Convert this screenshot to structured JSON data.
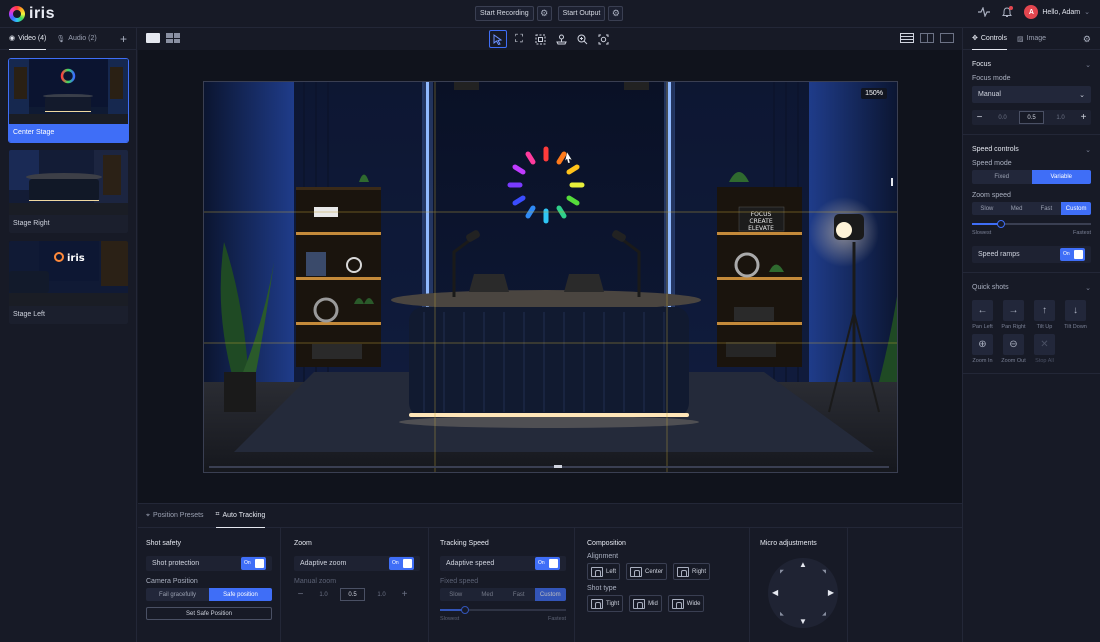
{
  "app": {
    "name": "iris"
  },
  "topbar": {
    "start_recording": "Start Recording",
    "start_output": "Start Output",
    "user_avatar_initial": "A",
    "greeting": "Hello, Adam"
  },
  "sources": {
    "video_tab": "Video (4)",
    "audio_tab": "Audio (2)",
    "items": [
      {
        "label": "Center Stage",
        "selected": true
      },
      {
        "label": "Stage Right",
        "selected": false
      },
      {
        "label": "Stage Left",
        "selected": false
      }
    ]
  },
  "preview": {
    "zoom": "150%",
    "sign_lines": [
      "FOCUS",
      "CREATE",
      "ELEVATE"
    ]
  },
  "bottom": {
    "tabs": [
      "Position Presets",
      "Auto Tracking"
    ],
    "active_tab": "Auto Tracking",
    "shot_safety": {
      "title": "Shot safety",
      "shot_protection": "Shot protection",
      "toggle_on": "On",
      "camera_position": "Camera Position",
      "options": [
        "Fail gracefully",
        "Safe position"
      ],
      "selected": "Safe position",
      "set_button": "Set Safe Position"
    },
    "zoom": {
      "title": "Zoom",
      "adaptive": "Adaptive zoom",
      "toggle_on": "On",
      "manual_label": "Manual zoom",
      "values": [
        "1.0",
        "0.5",
        "1.0"
      ]
    },
    "tracking_speed": {
      "title": "Tracking Speed",
      "adaptive": "Adaptive speed",
      "toggle_on": "On",
      "fixed_label": "Fixed speed",
      "options": [
        "Slow",
        "Med",
        "Fast",
        "Custom"
      ],
      "selected": "Custom",
      "slowest": "Slowest",
      "fastest": "Fastest",
      "level": 0.2
    },
    "composition": {
      "title": "Composition",
      "alignment_label": "Alignment",
      "alignment": [
        "Left",
        "Center",
        "Right"
      ],
      "shot_type_label": "Shot type",
      "shot_types": [
        "Tight",
        "Mid",
        "Wide"
      ]
    },
    "micro": {
      "title": "Micro adjustments"
    }
  },
  "right": {
    "tabs": [
      "Controls",
      "Image"
    ],
    "focus": {
      "title": "Focus",
      "mode_label": "Focus mode",
      "mode_value": "Manual",
      "values": [
        "0.0",
        "0.5",
        "1.0"
      ]
    },
    "speed": {
      "title": "Speed controls",
      "mode_label": "Speed mode",
      "modes": [
        "Fixed",
        "Variable"
      ],
      "selected_mode": "Variable",
      "zoom_speed_label": "Zoom speed",
      "zoom_options": [
        "Slow",
        "Med",
        "Fast",
        "Custom"
      ],
      "zoom_selected": "Custom",
      "slowest": "Slowest",
      "fastest": "Fastest",
      "level": 0.24,
      "ramps": "Speed ramps",
      "toggle_on": "On"
    },
    "quick_shots": {
      "title": "Quick shots",
      "items": [
        {
          "label": "Pan Left",
          "icon": "arrow-left-icon",
          "glyph": "←"
        },
        {
          "label": "Pan Right",
          "icon": "arrow-right-icon",
          "glyph": "→"
        },
        {
          "label": "Tilt Up",
          "icon": "arrow-up-icon",
          "glyph": "↑"
        },
        {
          "label": "Tilt Down",
          "icon": "arrow-down-icon",
          "glyph": "↓"
        },
        {
          "label": "Zoom In",
          "icon": "zoom-in-icon",
          "glyph": "⊕"
        },
        {
          "label": "Zoom Out",
          "icon": "zoom-out-icon",
          "glyph": "⊖"
        },
        {
          "label": "Stop All",
          "icon": "stop-icon",
          "glyph": "✕"
        }
      ]
    }
  },
  "colors": {
    "accent": "#3f6ef7",
    "bg": "#171a26",
    "panel": "#22273a"
  }
}
